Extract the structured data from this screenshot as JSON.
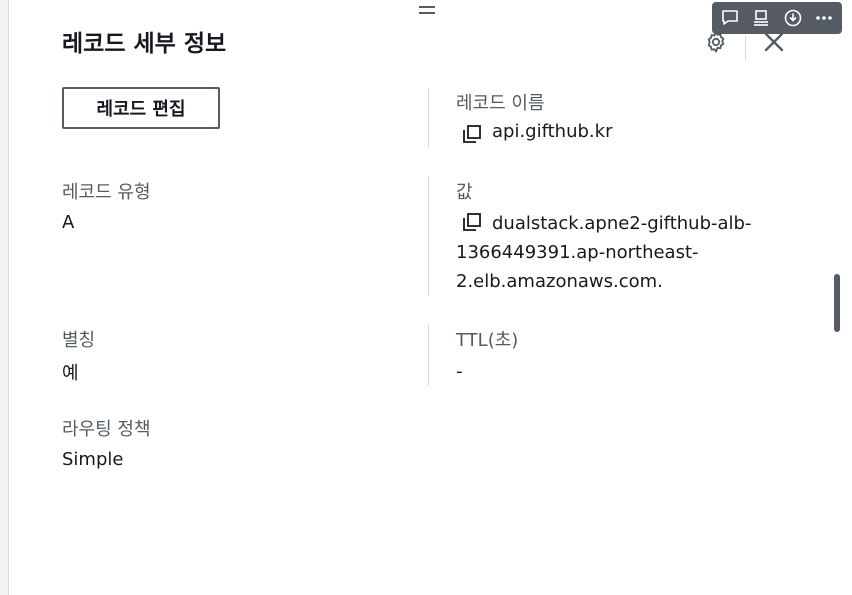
{
  "panel": {
    "title": "레코드 세부 정보",
    "edit_button": "레코드 편집"
  },
  "toolbar": {
    "icons": [
      "comment-icon",
      "panel-icon",
      "download-icon",
      "more-icon"
    ]
  },
  "fields": {
    "record_name": {
      "label": "레코드 이름",
      "value": "api.gifthub.kr"
    },
    "record_type": {
      "label": "레코드 유형",
      "value": "A"
    },
    "value": {
      "label": "값",
      "lines": [
        "dualstack.apne2-gifthub-alb-",
        "1366449391.ap-northeast-",
        "2.elb.amazonaws.com."
      ]
    },
    "alias": {
      "label": "별칭",
      "value": "예"
    },
    "ttl": {
      "label": "TTL(초)",
      "value": "-"
    },
    "routing_policy": {
      "label": "라우팅 정책",
      "value": "Simple"
    }
  },
  "colors": {
    "text": "#16191f",
    "label": "#545b64",
    "divider": "#d5dbdb",
    "toolbar": "#545b64"
  }
}
